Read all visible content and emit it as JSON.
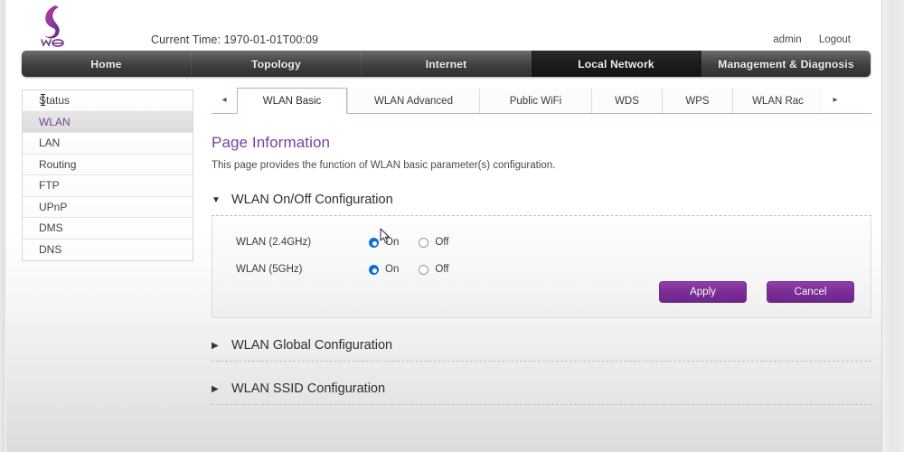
{
  "header": {
    "logo_name": "we-logo",
    "current_time_label": "Current Time: 1970-01-01T00:09",
    "account": "admin",
    "logout": "Logout"
  },
  "mainnav": {
    "items": [
      {
        "label": "Home",
        "active": false
      },
      {
        "label": "Topology",
        "active": false
      },
      {
        "label": "Internet",
        "active": false
      },
      {
        "label": "Local Network",
        "active": true
      },
      {
        "label": "Management & Diagnosis",
        "active": false
      }
    ]
  },
  "sidebar": {
    "items": [
      {
        "label": "Status",
        "active": false
      },
      {
        "label": "WLAN",
        "active": true
      },
      {
        "label": "LAN",
        "active": false
      },
      {
        "label": "Routing",
        "active": false
      },
      {
        "label": "FTP",
        "active": false
      },
      {
        "label": "UPnP",
        "active": false
      },
      {
        "label": "DMS",
        "active": false
      },
      {
        "label": "DNS",
        "active": false
      }
    ]
  },
  "subtabs": {
    "prev_arrow": "◂",
    "next_arrow": "▸",
    "items": [
      {
        "label": "WLAN Basic",
        "active": true
      },
      {
        "label": "WLAN Advanced",
        "active": false
      },
      {
        "label": "Public WiFi",
        "active": false
      },
      {
        "label": "WDS",
        "active": false
      },
      {
        "label": "WPS",
        "active": false
      },
      {
        "label": "WLAN Rac",
        "active": false
      }
    ]
  },
  "main": {
    "page_title": "Page Information",
    "page_desc": "This page provides the function of WLAN basic parameter(s) configuration.",
    "sections": [
      {
        "toggle_icon": "▼",
        "label": "WLAN On/Off Configuration",
        "expanded": true
      },
      {
        "toggle_icon": "▶",
        "label": "WLAN Global Configuration",
        "expanded": false
      },
      {
        "toggle_icon": "▶",
        "label": "WLAN SSID Configuration",
        "expanded": false
      }
    ],
    "form": {
      "rows": [
        {
          "label": "WLAN (2.4GHz)",
          "on_label": "On",
          "off_label": "Off",
          "value": "On"
        },
        {
          "label": "WLAN (5GHz)",
          "on_label": "On",
          "off_label": "Off",
          "value": "On"
        }
      ],
      "apply_label": "Apply",
      "cancel_label": "Cancel"
    }
  },
  "colors": {
    "brand_purple": "#7b3f9d",
    "button_purple": "#7b2d96",
    "radio_blue": "#0d6fd1",
    "nav_dark": "#2e2e2e",
    "tab_border": "#c9a8cd"
  }
}
